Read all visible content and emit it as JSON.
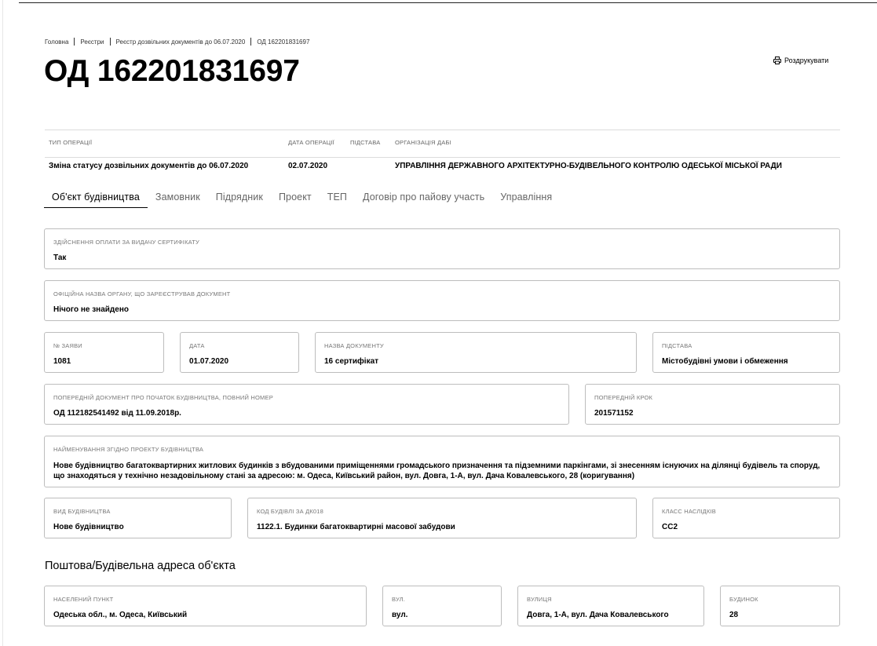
{
  "breadcrumb": [
    "Головна",
    "Реєстри",
    "Реєстр дозвільних документів до 06.07.2020",
    "ОД 162201831697"
  ],
  "title": "ОД 162201831697",
  "print_label": "Роздрукувати",
  "operation": {
    "headers": {
      "type": "ТИП ОПЕРАЦІЇ",
      "date": "ДАТА ОПЕРАЦІЇ",
      "basis": "ПІДСТАВА",
      "org": "ОРГАНІЗАЦІЯ ДАБІ"
    },
    "values": {
      "type": "Зміна статусу дозвільних документів до 06.07.2020",
      "date": "02.07.2020",
      "basis": "",
      "org": "УПРАВЛІННЯ ДЕРЖАВНОГО АРХІТЕКТУРНО-БУДІВЕЛЬНОГО КОНТРОЛЮ ОДЕСЬКОЇ МІСЬКОЇ РАДИ"
    }
  },
  "tabs": [
    "Об'єкт будівництва",
    "Замовник",
    "Підрядник",
    "Проект",
    "ТЕП",
    "Договір про пайову участь",
    "Управління"
  ],
  "fields": {
    "payment": {
      "label": "ЗДІЙСНЕННЯ ОПЛАТИ ЗА ВИДАЧУ СЕРТИФІКАТУ",
      "value": "Так"
    },
    "official_body": {
      "label": "ОФІЦІЙНА НАЗВА ОРГАНУ, ЩО ЗАРЕЄСТРУВАВ ДОКУМЕНТ",
      "value": "Нічого не знайдено"
    },
    "application_no": {
      "label": "№ ЗАЯВИ",
      "value": "1081"
    },
    "date": {
      "label": "ДАТА",
      "value": "01.07.2020"
    },
    "doc_name": {
      "label": "НАЗВА ДОКУМЕНТУ",
      "value": "16 сертифікат"
    },
    "basis": {
      "label": "ПІДСТАВА",
      "value": "Містобудівні умови і обмеження"
    },
    "prev_doc": {
      "label": "ПОПЕРЕДНІЙ ДОКУМЕНТ ПРО ПОЧАТОК БУДІВНИЦТВА, ПОВНИЙ НОМЕР",
      "value": "ОД 112182541492 від 11.09.2018р."
    },
    "prev_step": {
      "label": "ПОПЕРЕДНІЙ КРОК",
      "value": "201571152"
    },
    "project_name": {
      "label": "НАЙМЕНУВАННЯ ЗГІДНО ПРОЕКТУ БУДІВНИЦТВА",
      "value": "Нове будівництво багатоквартирних житлових будинків з вбудованими приміщеннями громадського призначення та підземними паркінгами, зі знесенням існуючих на ділянці будівель та споруд, що знаходяться у технічно незадовільному стані за адресою: м. Одеса, Київський район, вул. Довга, 1-А, вул. Дача Ковалевського, 28 (коригування)"
    },
    "construction_type": {
      "label": "ВИД БУДІВНИЦТВА",
      "value": "Нове будівництво"
    },
    "building_code": {
      "label": "КОД БУДІВЛІ ЗА ДК018",
      "value": "1122.1. Будинки багатоквартирні масової забудови"
    },
    "consequence_class": {
      "label": "КЛАСС НАСЛІДКІВ",
      "value": "СС2"
    }
  },
  "address": {
    "title": "Поштова/Будівельна адреса об'єкта",
    "settlement": {
      "label": "НАСЕЛЕНИЙ ПУНКТ",
      "value": "Одеська обл., м. Одеса, Київський"
    },
    "street_type": {
      "label": "ВУЛ.",
      "value": "вул."
    },
    "street": {
      "label": "ВУЛИЦЯ",
      "value": "Довга, 1-А, вул. Дача Ковалевського"
    },
    "building": {
      "label": "БУДИНОК",
      "value": "28"
    }
  },
  "icons": {
    "print": "printer-icon"
  },
  "colors": {
    "text": "#000000",
    "muted": "#666666",
    "border": "#bdbdbd"
  }
}
